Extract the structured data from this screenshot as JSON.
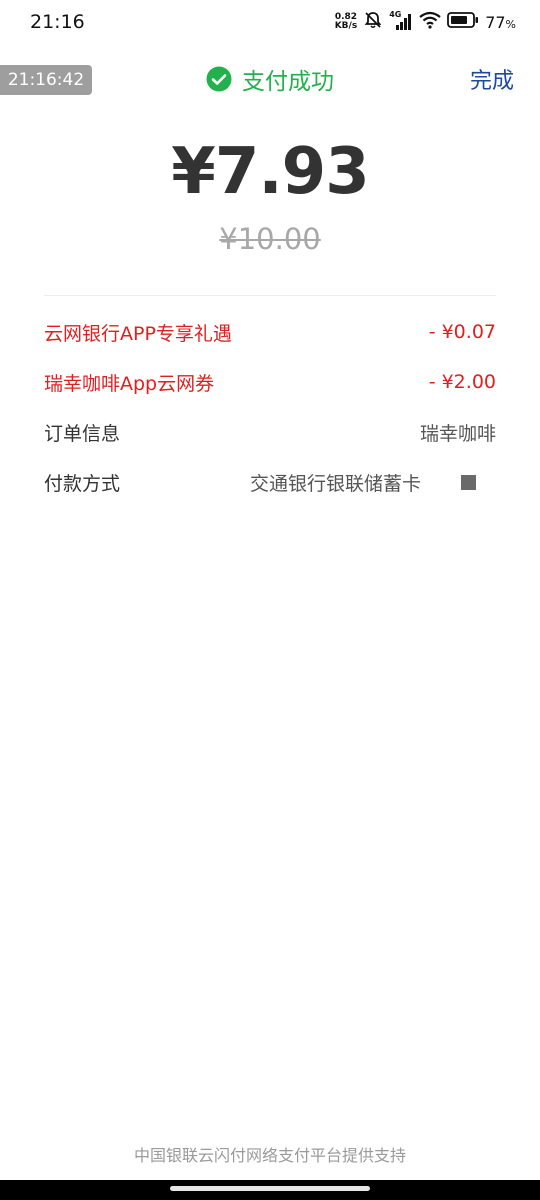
{
  "status_bar": {
    "time": "21:16",
    "speed_value": "0.82",
    "speed_unit": "KB/s",
    "network": "4G",
    "battery_percent": "77",
    "battery_unit": "%"
  },
  "header": {
    "timestamp": "21:16:42",
    "title": "支付成功",
    "done_label": "完成"
  },
  "payment": {
    "amount": "¥7.93",
    "original_amount": "¥10.00"
  },
  "details": {
    "discount_rows": [
      {
        "label": "云网银行APP专享礼遇",
        "value": "- ¥0.07"
      },
      {
        "label": "瑞幸咖啡App云网券",
        "value": "- ¥2.00"
      }
    ],
    "order_label": "订单信息",
    "order_value": "瑞幸咖啡",
    "method_label": "付款方式",
    "method_value": "交通银行银联储蓄卡"
  },
  "footer": {
    "text": "中国银联云闪付网络支付平台提供支持"
  },
  "colors": {
    "success_green": "#22b14c",
    "discount_red": "#e02020",
    "link_blue": "#1b4aa0"
  }
}
